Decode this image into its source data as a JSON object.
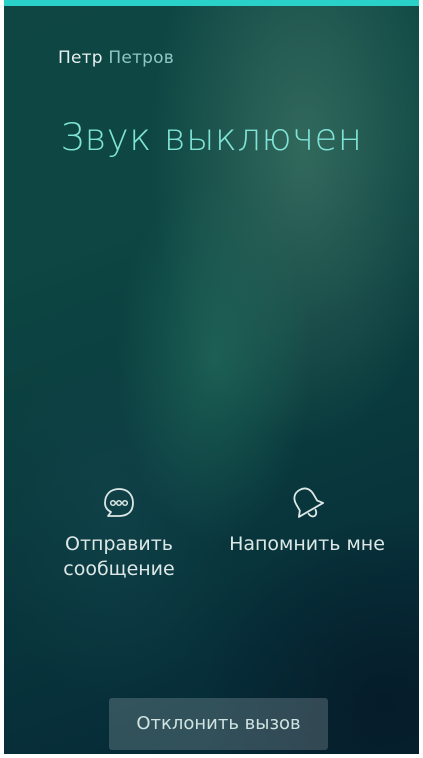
{
  "caller": {
    "first_name": "Петр",
    "last_name": "Петров"
  },
  "call_status": "Звук выключен",
  "actions": {
    "send_message": {
      "label": "Отправить\nсообщение",
      "icon": "chat-bubble-icon"
    },
    "remind_me": {
      "label": "Напомнить мне",
      "icon": "bell-icon"
    }
  },
  "decline_button": {
    "label": "Отклонить вызов"
  },
  "colors": {
    "accent": "#2ad1c9",
    "status_text": "#7fe3d6",
    "background_top": "#0f4644",
    "background_bottom": "#052633"
  }
}
